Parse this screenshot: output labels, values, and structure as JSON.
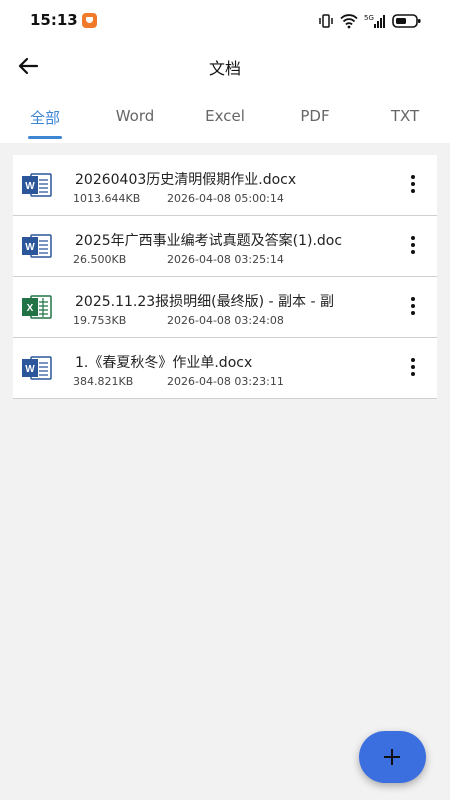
{
  "status_bar": {
    "time": "15:13",
    "icons": [
      "notification-app-icon",
      "vibrate-icon",
      "wifi-icon",
      "5g-signal-icon",
      "battery-icon"
    ]
  },
  "header": {
    "title": "文档",
    "back_icon": "arrow-left-icon"
  },
  "tabs": [
    {
      "label": "全部",
      "active": true
    },
    {
      "label": "Word",
      "active": false
    },
    {
      "label": "Excel",
      "active": false
    },
    {
      "label": "PDF",
      "active": false
    },
    {
      "label": "TXT",
      "active": false
    }
  ],
  "files": [
    {
      "type": "word",
      "name": "20260403历史清明假期作业.docx",
      "size": "1013.644KB",
      "date": "2026-04-08 05:00:14"
    },
    {
      "type": "word",
      "name": "2025年广西事业编考试真题及答案(1).doc",
      "size": "26.500KB",
      "date": "2026-04-08 03:25:14"
    },
    {
      "type": "excel",
      "name": "2025.11.23报损明细(最终版) - 副本 - 副",
      "size": "19.753KB",
      "date": "2026-04-08 03:24:08"
    },
    {
      "type": "word",
      "name": "1.《春夏秋冬》作业单.docx",
      "size": "384.821KB",
      "date": "2026-04-08 03:23:11"
    }
  ],
  "fab": {
    "icon": "plus-icon"
  },
  "colors": {
    "accent": "#3d86d4",
    "fab": "#3b6fe0",
    "word": "#2b579a",
    "excel": "#217346",
    "background": "#f2f2f2"
  }
}
